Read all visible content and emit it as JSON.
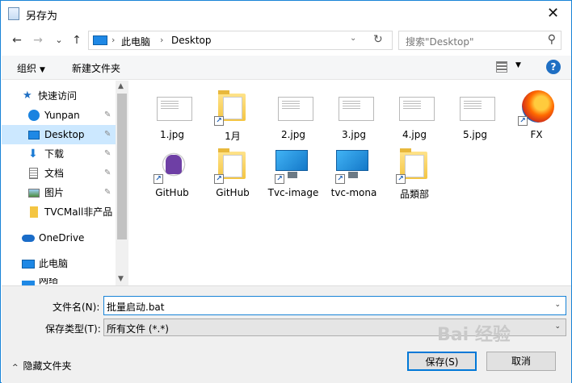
{
  "window": {
    "title": "另存为",
    "close_glyph": "✕"
  },
  "nav": {
    "back": "←",
    "forward": "→",
    "recent": "⌄",
    "up": "↑",
    "breadcrumbs": [
      "此电脑",
      "Desktop"
    ],
    "dropdown": "⌄",
    "refresh": "↻"
  },
  "search": {
    "placeholder": "搜索\"Desktop\"",
    "icon": "⚲"
  },
  "toolbar": {
    "organize": "组织",
    "organize_caret": "▼",
    "new_folder": "新建文件夹",
    "view_caret": "▼",
    "help": "?"
  },
  "sidebar": {
    "items": [
      {
        "label": "快速访问",
        "icon": "star-icon",
        "pinned": false
      },
      {
        "label": "Yunpan",
        "icon": "cloud-icon",
        "pinned": true
      },
      {
        "label": "Desktop",
        "icon": "desktop-icon",
        "pinned": true,
        "selected": true
      },
      {
        "label": "下载",
        "icon": "download-icon",
        "pinned": true
      },
      {
        "label": "文档",
        "icon": "document-icon",
        "pinned": true
      },
      {
        "label": "图片",
        "icon": "pictures-icon",
        "pinned": true
      },
      {
        "label": "TVCMall非产品",
        "icon": "folder-icon",
        "pinned": false
      },
      {
        "label": "OneDrive",
        "icon": "onedrive-icon",
        "pinned": false
      },
      {
        "label": "此电脑",
        "icon": "computer-icon",
        "pinned": false
      },
      {
        "label": "网络",
        "icon": "network-icon",
        "pinned": false
      }
    ],
    "pin_glyph": "📌"
  },
  "files": [
    {
      "name": "1.jpg",
      "type": "image"
    },
    {
      "name": "1月",
      "type": "folder",
      "shortcut": true
    },
    {
      "name": "2.jpg",
      "type": "image"
    },
    {
      "name": "3.jpg",
      "type": "image"
    },
    {
      "name": "4.jpg",
      "type": "image"
    },
    {
      "name": "5.jpg",
      "type": "image"
    },
    {
      "name": "FX",
      "type": "firefox",
      "shortcut": true
    },
    {
      "name": "GitHub",
      "type": "github",
      "shortcut": true
    },
    {
      "name": "GitHub",
      "type": "folder",
      "shortcut": true
    },
    {
      "name": "Tvc-image",
      "type": "monitor",
      "shortcut": true
    },
    {
      "name": "tvc-mona",
      "type": "monitor",
      "shortcut": true
    },
    {
      "name": "品類部",
      "type": "folder",
      "shortcut": true
    }
  ],
  "bottom": {
    "filename_label": "文件名(N):",
    "filename_value": "批量启动.bat",
    "filetype_label": "保存类型(T):",
    "filetype_value": "所有文件 (*.*)",
    "hide_folders": "隐藏文件夹",
    "hide_chevron": "^",
    "save": "保存(S)",
    "cancel": "取消",
    "caret": "⌄"
  },
  "watermark": "Bai 经验",
  "colors": {
    "accent": "#0078d7",
    "selected": "#cce8ff",
    "border": "#1883d7"
  }
}
